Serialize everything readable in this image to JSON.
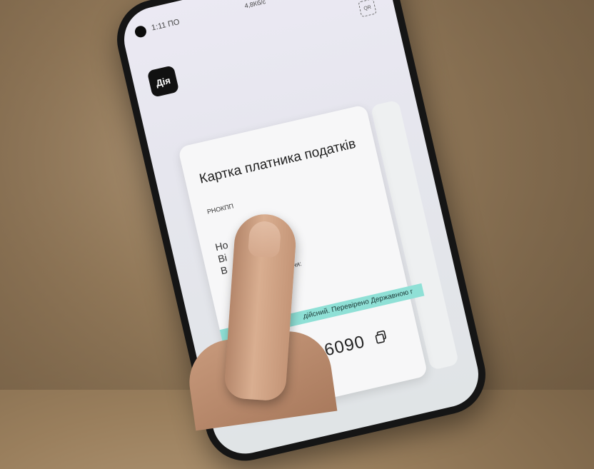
{
  "status_bar": {
    "time": "1:11 ПО",
    "speed": "4,8Кб/с",
    "icons": [
      "bluetooth-icon",
      "alarm-icon",
      "signal-icon",
      "wifi-icon",
      "battery-icon"
    ]
  },
  "app": {
    "logo_text": "Дія",
    "qr_label": "QR"
  },
  "card": {
    "title": "Картка платника податків",
    "subtitle": "РНОКПП",
    "name_line1": "Но",
    "name_line2": "Ві          ович",
    "name_line3": "В",
    "label_partial": "ня:",
    "ribbon_text": "дійсний. Перевірено Державною г",
    "number": "416090"
  },
  "colors": {
    "ribbon": "#8fe0d6",
    "card_bg": "#f7f7f8",
    "logo_bg": "#111111"
  }
}
